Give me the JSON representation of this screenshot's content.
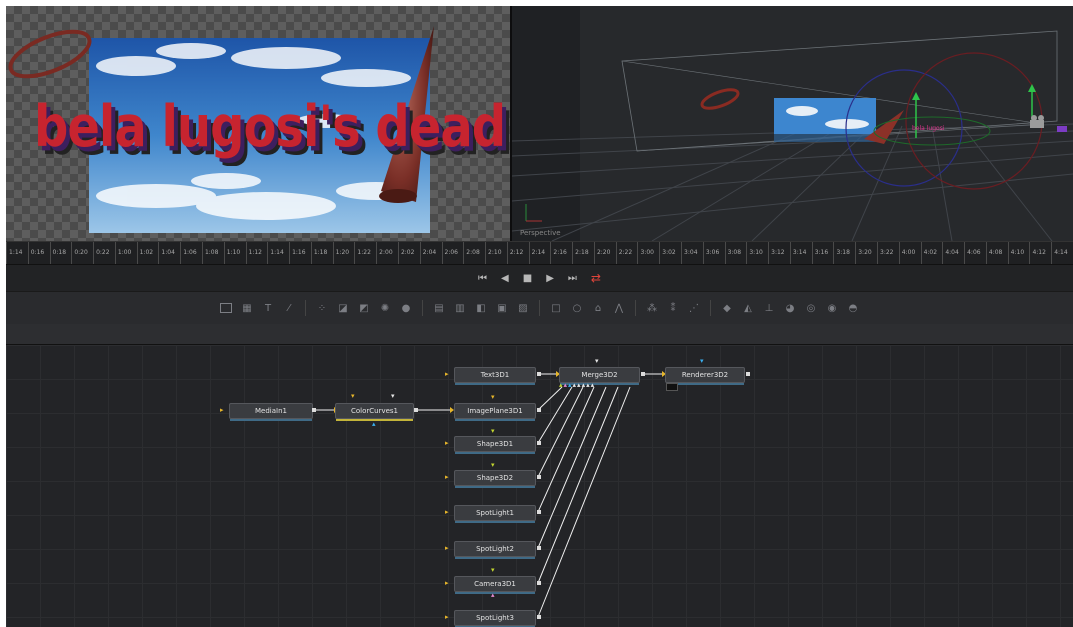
{
  "viewer_left": {
    "title_text": "bela lugosi's dead"
  },
  "viewer_right": {
    "view_label": "Perspective"
  },
  "ruler": {
    "ticks": [
      "1:14",
      "0:16",
      "0:18",
      "0:20",
      "0:22",
      "1:00",
      "1:02",
      "1:04",
      "1:06",
      "1:08",
      "1:10",
      "1:12",
      "1:14",
      "1:16",
      "1:18",
      "1:20",
      "1:22",
      "2:00",
      "2:02",
      "2:04",
      "2:06",
      "2:08",
      "2:10",
      "2:12",
      "2:14",
      "2:16",
      "2:18",
      "2:20",
      "2:22",
      "3:00",
      "3:02",
      "3:04",
      "3:06",
      "3:08",
      "3:10",
      "3:12",
      "3:14",
      "3:16",
      "3:18",
      "3:20",
      "3:22",
      "4:00",
      "4:02",
      "4:04",
      "4:06",
      "4:08",
      "4:10",
      "4:12",
      "4:14"
    ]
  },
  "transport": {
    "first_frame": "⏮",
    "step_back": "◀",
    "stop": "■",
    "play": "▶",
    "last_frame": "⏭",
    "loop": "⇄"
  },
  "toolbar": {
    "icons": [
      "bg-icon",
      "mask-icon",
      "text-icon",
      "paint-icon",
      "blur-icon",
      "brightness-icon",
      "colorcorrect-icon",
      "light-icon",
      "drop-icon",
      "merge-icon",
      "loader-icon",
      "saver-icon",
      "channel-icon",
      "transform-icon",
      "rectangle-icon",
      "ellipse-icon",
      "polygon-icon",
      "bspline-icon",
      "particle-emitter-icon",
      "particle-render-icon",
      "particle-icon",
      "shape3d-icon",
      "text3d-icon",
      "camera3d-icon",
      "light3d-icon",
      "renderer3d-icon",
      "merge3d-icon",
      "image3d-icon"
    ]
  },
  "nodes": {
    "mediain1": "MediaIn1",
    "colorcurves1": "ColorCurves1",
    "text3d1": "Text3D1",
    "imageplane3d1": "ImagePlane3D1",
    "shape3d1": "Shape3D1",
    "shape3d2": "Shape3D2",
    "spotlight1": "SpotLight1",
    "spotlight2": "SpotLight2",
    "camera3d1": "Camera3D1",
    "spotlight3": "SpotLight3",
    "merge3d2": "Merge3D2",
    "renderer3d2": "Renderer3D2"
  },
  "colors": {
    "link": "#f5f5f5",
    "accent_red": "#e0443a",
    "node_bar": "#3f6a86",
    "port_in": "#e7b62b"
  }
}
